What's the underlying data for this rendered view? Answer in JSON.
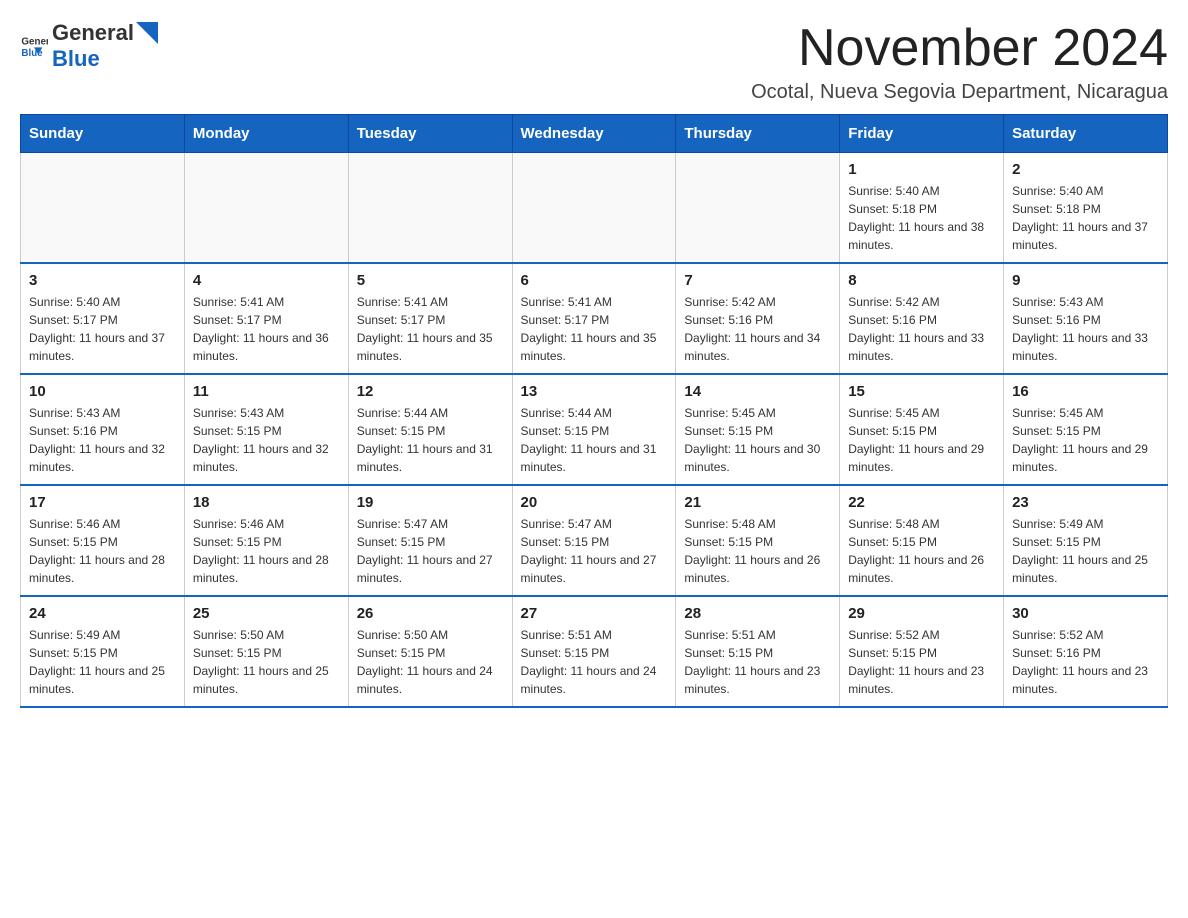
{
  "header": {
    "logo_general": "General",
    "logo_blue": "Blue",
    "month_title": "November 2024",
    "location": "Ocotal, Nueva Segovia Department, Nicaragua"
  },
  "weekdays": [
    "Sunday",
    "Monday",
    "Tuesday",
    "Wednesday",
    "Thursday",
    "Friday",
    "Saturday"
  ],
  "weeks": [
    [
      {
        "day": "",
        "info": ""
      },
      {
        "day": "",
        "info": ""
      },
      {
        "day": "",
        "info": ""
      },
      {
        "day": "",
        "info": ""
      },
      {
        "day": "",
        "info": ""
      },
      {
        "day": "1",
        "info": "Sunrise: 5:40 AM\nSunset: 5:18 PM\nDaylight: 11 hours and 38 minutes."
      },
      {
        "day": "2",
        "info": "Sunrise: 5:40 AM\nSunset: 5:18 PM\nDaylight: 11 hours and 37 minutes."
      }
    ],
    [
      {
        "day": "3",
        "info": "Sunrise: 5:40 AM\nSunset: 5:17 PM\nDaylight: 11 hours and 37 minutes."
      },
      {
        "day": "4",
        "info": "Sunrise: 5:41 AM\nSunset: 5:17 PM\nDaylight: 11 hours and 36 minutes."
      },
      {
        "day": "5",
        "info": "Sunrise: 5:41 AM\nSunset: 5:17 PM\nDaylight: 11 hours and 35 minutes."
      },
      {
        "day": "6",
        "info": "Sunrise: 5:41 AM\nSunset: 5:17 PM\nDaylight: 11 hours and 35 minutes."
      },
      {
        "day": "7",
        "info": "Sunrise: 5:42 AM\nSunset: 5:16 PM\nDaylight: 11 hours and 34 minutes."
      },
      {
        "day": "8",
        "info": "Sunrise: 5:42 AM\nSunset: 5:16 PM\nDaylight: 11 hours and 33 minutes."
      },
      {
        "day": "9",
        "info": "Sunrise: 5:43 AM\nSunset: 5:16 PM\nDaylight: 11 hours and 33 minutes."
      }
    ],
    [
      {
        "day": "10",
        "info": "Sunrise: 5:43 AM\nSunset: 5:16 PM\nDaylight: 11 hours and 32 minutes."
      },
      {
        "day": "11",
        "info": "Sunrise: 5:43 AM\nSunset: 5:15 PM\nDaylight: 11 hours and 32 minutes."
      },
      {
        "day": "12",
        "info": "Sunrise: 5:44 AM\nSunset: 5:15 PM\nDaylight: 11 hours and 31 minutes."
      },
      {
        "day": "13",
        "info": "Sunrise: 5:44 AM\nSunset: 5:15 PM\nDaylight: 11 hours and 31 minutes."
      },
      {
        "day": "14",
        "info": "Sunrise: 5:45 AM\nSunset: 5:15 PM\nDaylight: 11 hours and 30 minutes."
      },
      {
        "day": "15",
        "info": "Sunrise: 5:45 AM\nSunset: 5:15 PM\nDaylight: 11 hours and 29 minutes."
      },
      {
        "day": "16",
        "info": "Sunrise: 5:45 AM\nSunset: 5:15 PM\nDaylight: 11 hours and 29 minutes."
      }
    ],
    [
      {
        "day": "17",
        "info": "Sunrise: 5:46 AM\nSunset: 5:15 PM\nDaylight: 11 hours and 28 minutes."
      },
      {
        "day": "18",
        "info": "Sunrise: 5:46 AM\nSunset: 5:15 PM\nDaylight: 11 hours and 28 minutes."
      },
      {
        "day": "19",
        "info": "Sunrise: 5:47 AM\nSunset: 5:15 PM\nDaylight: 11 hours and 27 minutes."
      },
      {
        "day": "20",
        "info": "Sunrise: 5:47 AM\nSunset: 5:15 PM\nDaylight: 11 hours and 27 minutes."
      },
      {
        "day": "21",
        "info": "Sunrise: 5:48 AM\nSunset: 5:15 PM\nDaylight: 11 hours and 26 minutes."
      },
      {
        "day": "22",
        "info": "Sunrise: 5:48 AM\nSunset: 5:15 PM\nDaylight: 11 hours and 26 minutes."
      },
      {
        "day": "23",
        "info": "Sunrise: 5:49 AM\nSunset: 5:15 PM\nDaylight: 11 hours and 25 minutes."
      }
    ],
    [
      {
        "day": "24",
        "info": "Sunrise: 5:49 AM\nSunset: 5:15 PM\nDaylight: 11 hours and 25 minutes."
      },
      {
        "day": "25",
        "info": "Sunrise: 5:50 AM\nSunset: 5:15 PM\nDaylight: 11 hours and 25 minutes."
      },
      {
        "day": "26",
        "info": "Sunrise: 5:50 AM\nSunset: 5:15 PM\nDaylight: 11 hours and 24 minutes."
      },
      {
        "day": "27",
        "info": "Sunrise: 5:51 AM\nSunset: 5:15 PM\nDaylight: 11 hours and 24 minutes."
      },
      {
        "day": "28",
        "info": "Sunrise: 5:51 AM\nSunset: 5:15 PM\nDaylight: 11 hours and 23 minutes."
      },
      {
        "day": "29",
        "info": "Sunrise: 5:52 AM\nSunset: 5:15 PM\nDaylight: 11 hours and 23 minutes."
      },
      {
        "day": "30",
        "info": "Sunrise: 5:52 AM\nSunset: 5:16 PM\nDaylight: 11 hours and 23 minutes."
      }
    ]
  ]
}
